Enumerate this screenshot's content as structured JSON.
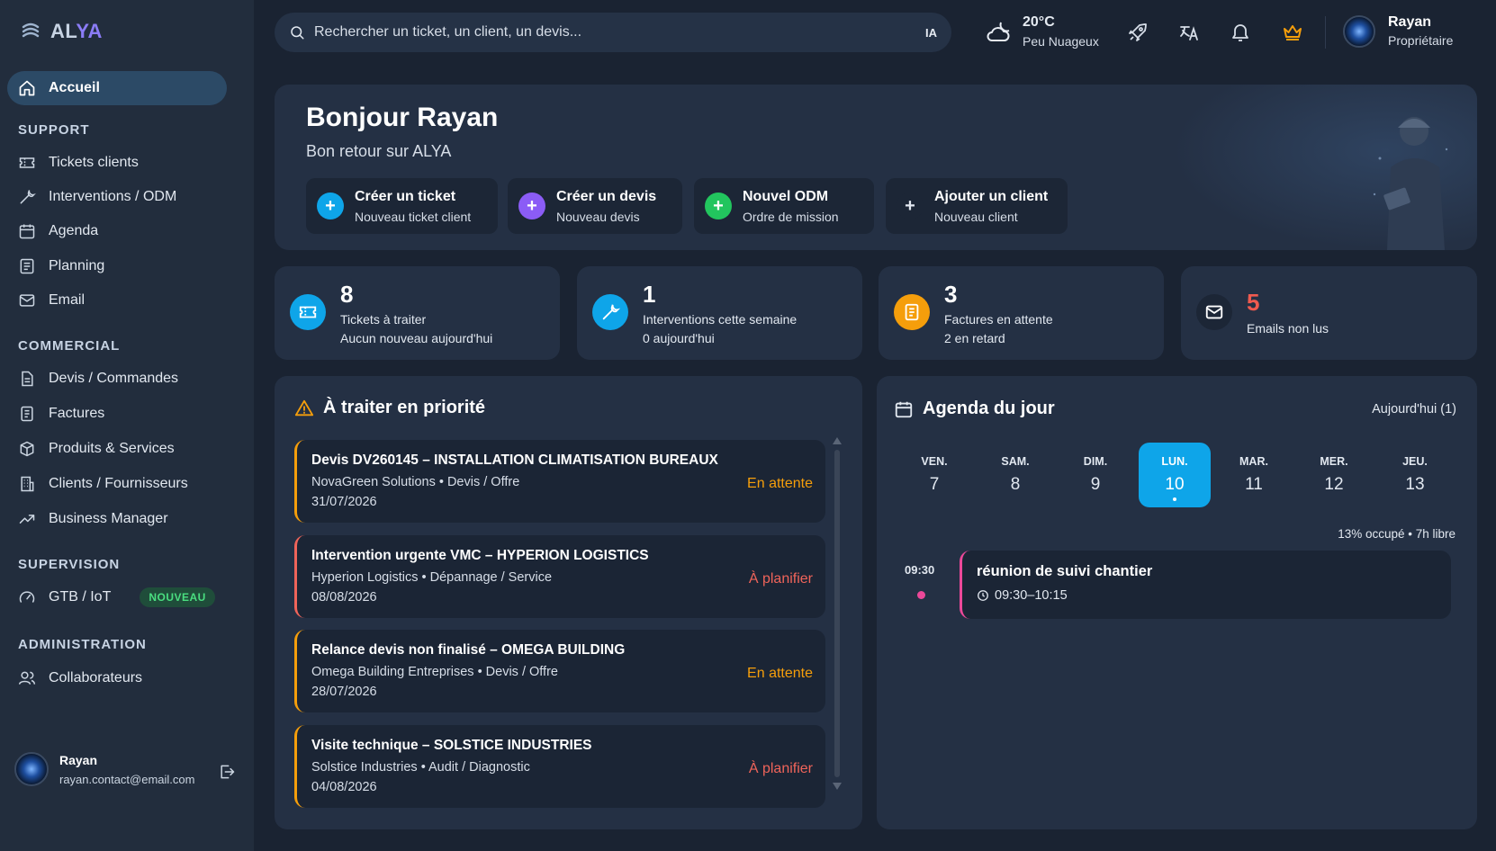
{
  "app": {
    "logo_a": "AL",
    "logo_b": "YA"
  },
  "sidebar": {
    "home": "Accueil",
    "sections": {
      "support": "SUPPORT",
      "commercial": "COMMERCIAL",
      "supervision": "SUPERVISION",
      "administration": "ADMINISTRATION"
    },
    "support_items": [
      "Tickets clients",
      "Interventions / ODM",
      "Agenda",
      "Planning",
      "Email"
    ],
    "commercial_items": [
      "Devis / Commandes",
      "Factures",
      "Produits & Services",
      "Clients / Fournisseurs",
      "Business Manager"
    ],
    "supervision_items": [
      "GTB / IoT"
    ],
    "new_badge": "NOUVEAU",
    "admin_items": [
      "Collaborateurs"
    ],
    "user": {
      "name": "Rayan",
      "email": "rayan.contact@email.com"
    }
  },
  "topbar": {
    "search_placeholder": "Rechercher un ticket, un client, un devis...",
    "ia_label": "IA",
    "weather": {
      "temp": "20°C",
      "condition": "Peu Nuageux"
    },
    "user": {
      "name": "Rayan",
      "role": "Propriétaire"
    }
  },
  "hero": {
    "title": "Bonjour Rayan",
    "subtitle": "Bon retour sur ALYA",
    "actions": [
      {
        "label": "Créer un ticket",
        "sub": "Nouveau ticket client",
        "color": "#0ea5e9",
        "symbol": "+"
      },
      {
        "label": "Créer un devis",
        "sub": "Nouveau devis",
        "color": "#8b5cf6",
        "symbol": "+"
      },
      {
        "label": "Nouvel ODM",
        "sub": "Ordre de mission",
        "color": "#22c55e",
        "symbol": "+"
      },
      {
        "label": "Ajouter un client",
        "sub": "Nouveau client",
        "color": "#1c2636",
        "symbol": "+"
      }
    ]
  },
  "stats": [
    {
      "value": "8",
      "line1": "Tickets à traiter",
      "line2": "Aucun nouveau aujourd'hui",
      "color": "#0ea5e9"
    },
    {
      "value": "1",
      "line1": "Interventions cette semaine",
      "line2": "0 aujourd'hui",
      "color": "#0ea5e9"
    },
    {
      "value": "3",
      "line1": "Factures en attente",
      "line2": "2 en retard",
      "color": "#f59e0b"
    },
    {
      "value": "5",
      "line1": "Emails non lus",
      "line2": "",
      "color": "#ef5a4f"
    }
  ],
  "priority": {
    "title": "À traiter en priorité",
    "items": [
      {
        "title": "Devis DV260145 – INSTALLATION CLIMATISATION BUREAUX",
        "meta": "NovaGreen Solutions • Devis / Offre",
        "date": "31/07/2026",
        "status": "En attente",
        "color": "#f59e0b"
      },
      {
        "title": "Intervention urgente VMC – HYPERION LOGISTICS",
        "meta": "Hyperion Logistics • Dépannage / Service",
        "date": "08/08/2026",
        "status": "À planifier",
        "color": "#f0645a"
      },
      {
        "title": "Relance devis non finalisé – OMEGA BUILDING",
        "meta": "Omega Building Entreprises • Devis / Offre",
        "date": "28/07/2026",
        "status": "En attente",
        "color": "#f59e0b"
      },
      {
        "title": "Visite technique – SOLSTICE INDUSTRIES",
        "meta": "Solstice Industries • Audit / Diagnostic",
        "date": "04/08/2026",
        "status": "À planifier",
        "color": "#f0645a"
      }
    ]
  },
  "agenda": {
    "title": "Agenda du jour",
    "today_label": "Aujourd'hui (1)",
    "days": [
      {
        "name": "VEN.",
        "num": "7"
      },
      {
        "name": "SAM.",
        "num": "8"
      },
      {
        "name": "DIM.",
        "num": "9"
      },
      {
        "name": "LUN.",
        "num": "10"
      },
      {
        "name": "MAR.",
        "num": "11"
      },
      {
        "name": "MER.",
        "num": "12"
      },
      {
        "name": "JEU.",
        "num": "13"
      }
    ],
    "selected_day": "LUN. 10",
    "occupancy": "13% occupé • 7h libre",
    "event": {
      "time": "09:30",
      "title": "réunion de suivi chantier",
      "range": "09:30–10:15"
    }
  }
}
